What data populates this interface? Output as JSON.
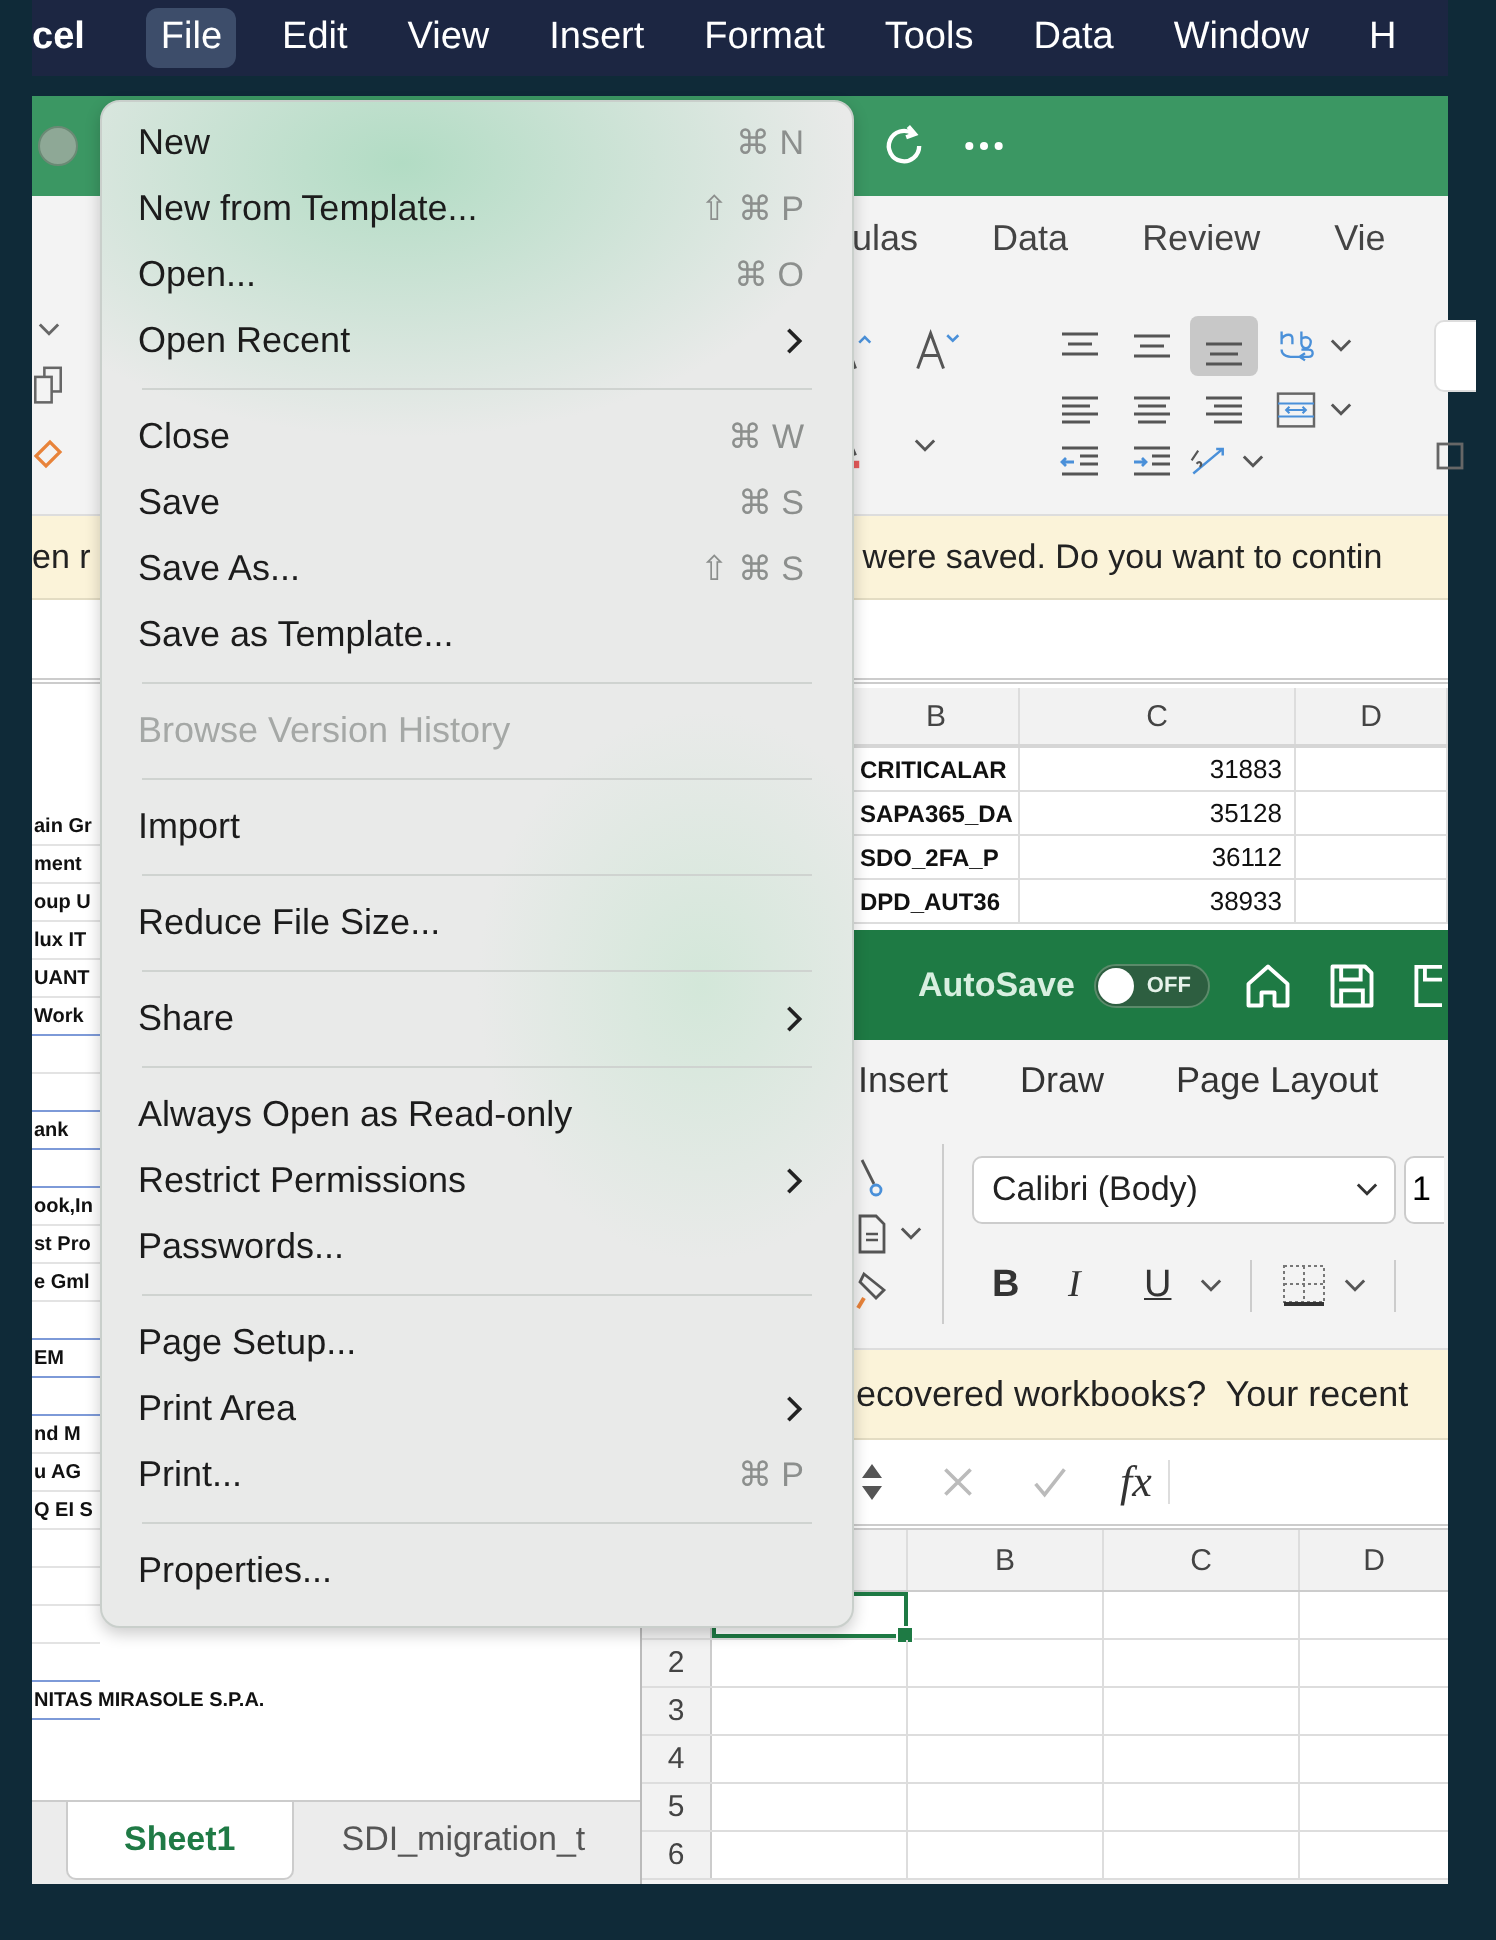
{
  "menu_bar": {
    "items": [
      {
        "label": "cel",
        "kind": "app",
        "selected": false
      },
      {
        "label": "File",
        "kind": "menu",
        "selected": true
      },
      {
        "label": "Edit",
        "kind": "menu",
        "selected": false
      },
      {
        "label": "View",
        "kind": "menu",
        "selected": false
      },
      {
        "label": "Insert",
        "kind": "menu",
        "selected": false
      },
      {
        "label": "Format",
        "kind": "menu",
        "selected": false
      },
      {
        "label": "Tools",
        "kind": "menu",
        "selected": false
      },
      {
        "label": "Data",
        "kind": "menu",
        "selected": false
      },
      {
        "label": "Window",
        "kind": "menu",
        "selected": false
      },
      {
        "label": "H",
        "kind": "menu",
        "selected": false
      }
    ]
  },
  "back_window": {
    "tabs": [
      "ulas",
      "Data",
      "Review",
      "Vie"
    ],
    "banner": {
      "start": "en r",
      "end": "were saved. Do you want to contin"
    },
    "column_headers": [
      "B",
      "C",
      "D"
    ],
    "rows": [
      {
        "cells": [
          "CRITICALAR",
          "31883",
          ""
        ]
      },
      {
        "cells": [
          "SAPA365_DA",
          "35128",
          ""
        ]
      },
      {
        "cells": [
          "SDO_2FA_P",
          "36112",
          ""
        ]
      },
      {
        "cells": [
          "DPD_AUT36",
          "38933",
          ""
        ]
      }
    ],
    "left_column": [
      {
        "kind": "cell",
        "text": "ain Gr",
        "rule": false
      },
      {
        "kind": "cell",
        "text": "ment",
        "rule": false
      },
      {
        "kind": "cell",
        "text": "oup U",
        "rule": false
      },
      {
        "kind": "cell",
        "text": "lux IT",
        "rule": false
      },
      {
        "kind": "cell",
        "text": "UANT",
        "rule": false
      },
      {
        "kind": "cell",
        "text": "Work",
        "rule": true
      },
      {
        "kind": "blank",
        "rule": false
      },
      {
        "kind": "blank",
        "rule": true
      },
      {
        "kind": "cell",
        "text": "ank",
        "rule": true
      },
      {
        "kind": "blank",
        "rule": true
      },
      {
        "kind": "cell",
        "text": "ook,In",
        "rule": false
      },
      {
        "kind": "cell",
        "text": "st Pro",
        "rule": false
      },
      {
        "kind": "cell",
        "text": "e Gml",
        "rule": false
      },
      {
        "kind": "blank",
        "rule": true
      },
      {
        "kind": "cell",
        "text": "EM",
        "rule": true
      },
      {
        "kind": "blank",
        "rule": true
      },
      {
        "kind": "cell",
        "text": "nd M",
        "rule": false
      },
      {
        "kind": "cell",
        "text": "u AG",
        "rule": false
      },
      {
        "kind": "cell",
        "text": "Q EI S",
        "rule": false
      },
      {
        "kind": "blank",
        "rule": false
      },
      {
        "kind": "blank",
        "rule": false
      },
      {
        "kind": "blank",
        "rule": false
      },
      {
        "kind": "blank",
        "rule": true
      },
      {
        "kind": "cell",
        "text": "NITAS MIRASOLE S.P.A.",
        "rule": true
      }
    ],
    "sheet_tabs": [
      {
        "label": "Sheet1",
        "selected": true
      },
      {
        "label": "SDI_migration_t",
        "selected": false
      }
    ]
  },
  "front_window": {
    "autosave": {
      "label": "AutoSave",
      "state": "OFF",
      "on": false
    },
    "tabs": [
      "Insert",
      "Draw",
      "Page Layout"
    ],
    "font": {
      "name": "Calibri (Body)",
      "size": "1"
    },
    "format_buttons": [
      "B",
      "I",
      "U"
    ],
    "banner": "ecovered workbooks?  Your recent",
    "formula_label": "fx",
    "column_headers": [
      "B",
      "C",
      "D"
    ],
    "rows": [
      {
        "selected": true
      },
      {
        "number": "2",
        "selected": false
      },
      {
        "number": "3",
        "selected": false
      },
      {
        "number": "4",
        "selected": false
      },
      {
        "number": "5",
        "selected": false
      },
      {
        "number": "6",
        "selected": false
      }
    ]
  },
  "file_menu": {
    "groups": [
      [
        {
          "label": "New",
          "shortcut": "⌘ N",
          "submenu": false,
          "disabled": false
        },
        {
          "label": "New from Template...",
          "shortcut": "⇧ ⌘ P",
          "submenu": false,
          "disabled": false
        },
        {
          "label": "Open...",
          "shortcut": "⌘ O",
          "submenu": false,
          "disabled": false
        },
        {
          "label": "Open Recent",
          "submenu": true,
          "disabled": false
        }
      ],
      [
        {
          "label": "Close",
          "shortcut": "⌘ W",
          "submenu": false,
          "disabled": false
        },
        {
          "label": "Save",
          "shortcut": "⌘ S",
          "submenu": false,
          "disabled": false
        },
        {
          "label": "Save As...",
          "shortcut": "⇧ ⌘ S",
          "submenu": false,
          "disabled": false
        },
        {
          "label": "Save as Template...",
          "submenu": false,
          "disabled": false
        }
      ],
      [
        {
          "label": "Browse Version History",
          "submenu": false,
          "disabled": true
        }
      ],
      [
        {
          "label": "Import",
          "submenu": false,
          "disabled": false
        }
      ],
      [
        {
          "label": "Reduce File Size...",
          "submenu": false,
          "disabled": false
        }
      ],
      [
        {
          "label": "Share",
          "submenu": true,
          "disabled": false
        }
      ],
      [
        {
          "label": "Always Open as Read-only",
          "submenu": false,
          "disabled": false
        },
        {
          "label": "Restrict Permissions",
          "submenu": true,
          "disabled": false
        },
        {
          "label": "Passwords...",
          "submenu": false,
          "disabled": false
        }
      ],
      [
        {
          "label": "Page Setup...",
          "submenu": false,
          "disabled": false
        },
        {
          "label": "Print Area",
          "submenu": true,
          "disabled": false
        },
        {
          "label": "Print...",
          "shortcut": "⌘ P",
          "submenu": false,
          "disabled": false
        }
      ],
      [
        {
          "label": "Properties...",
          "submenu": false,
          "disabled": false
        }
      ]
    ]
  }
}
